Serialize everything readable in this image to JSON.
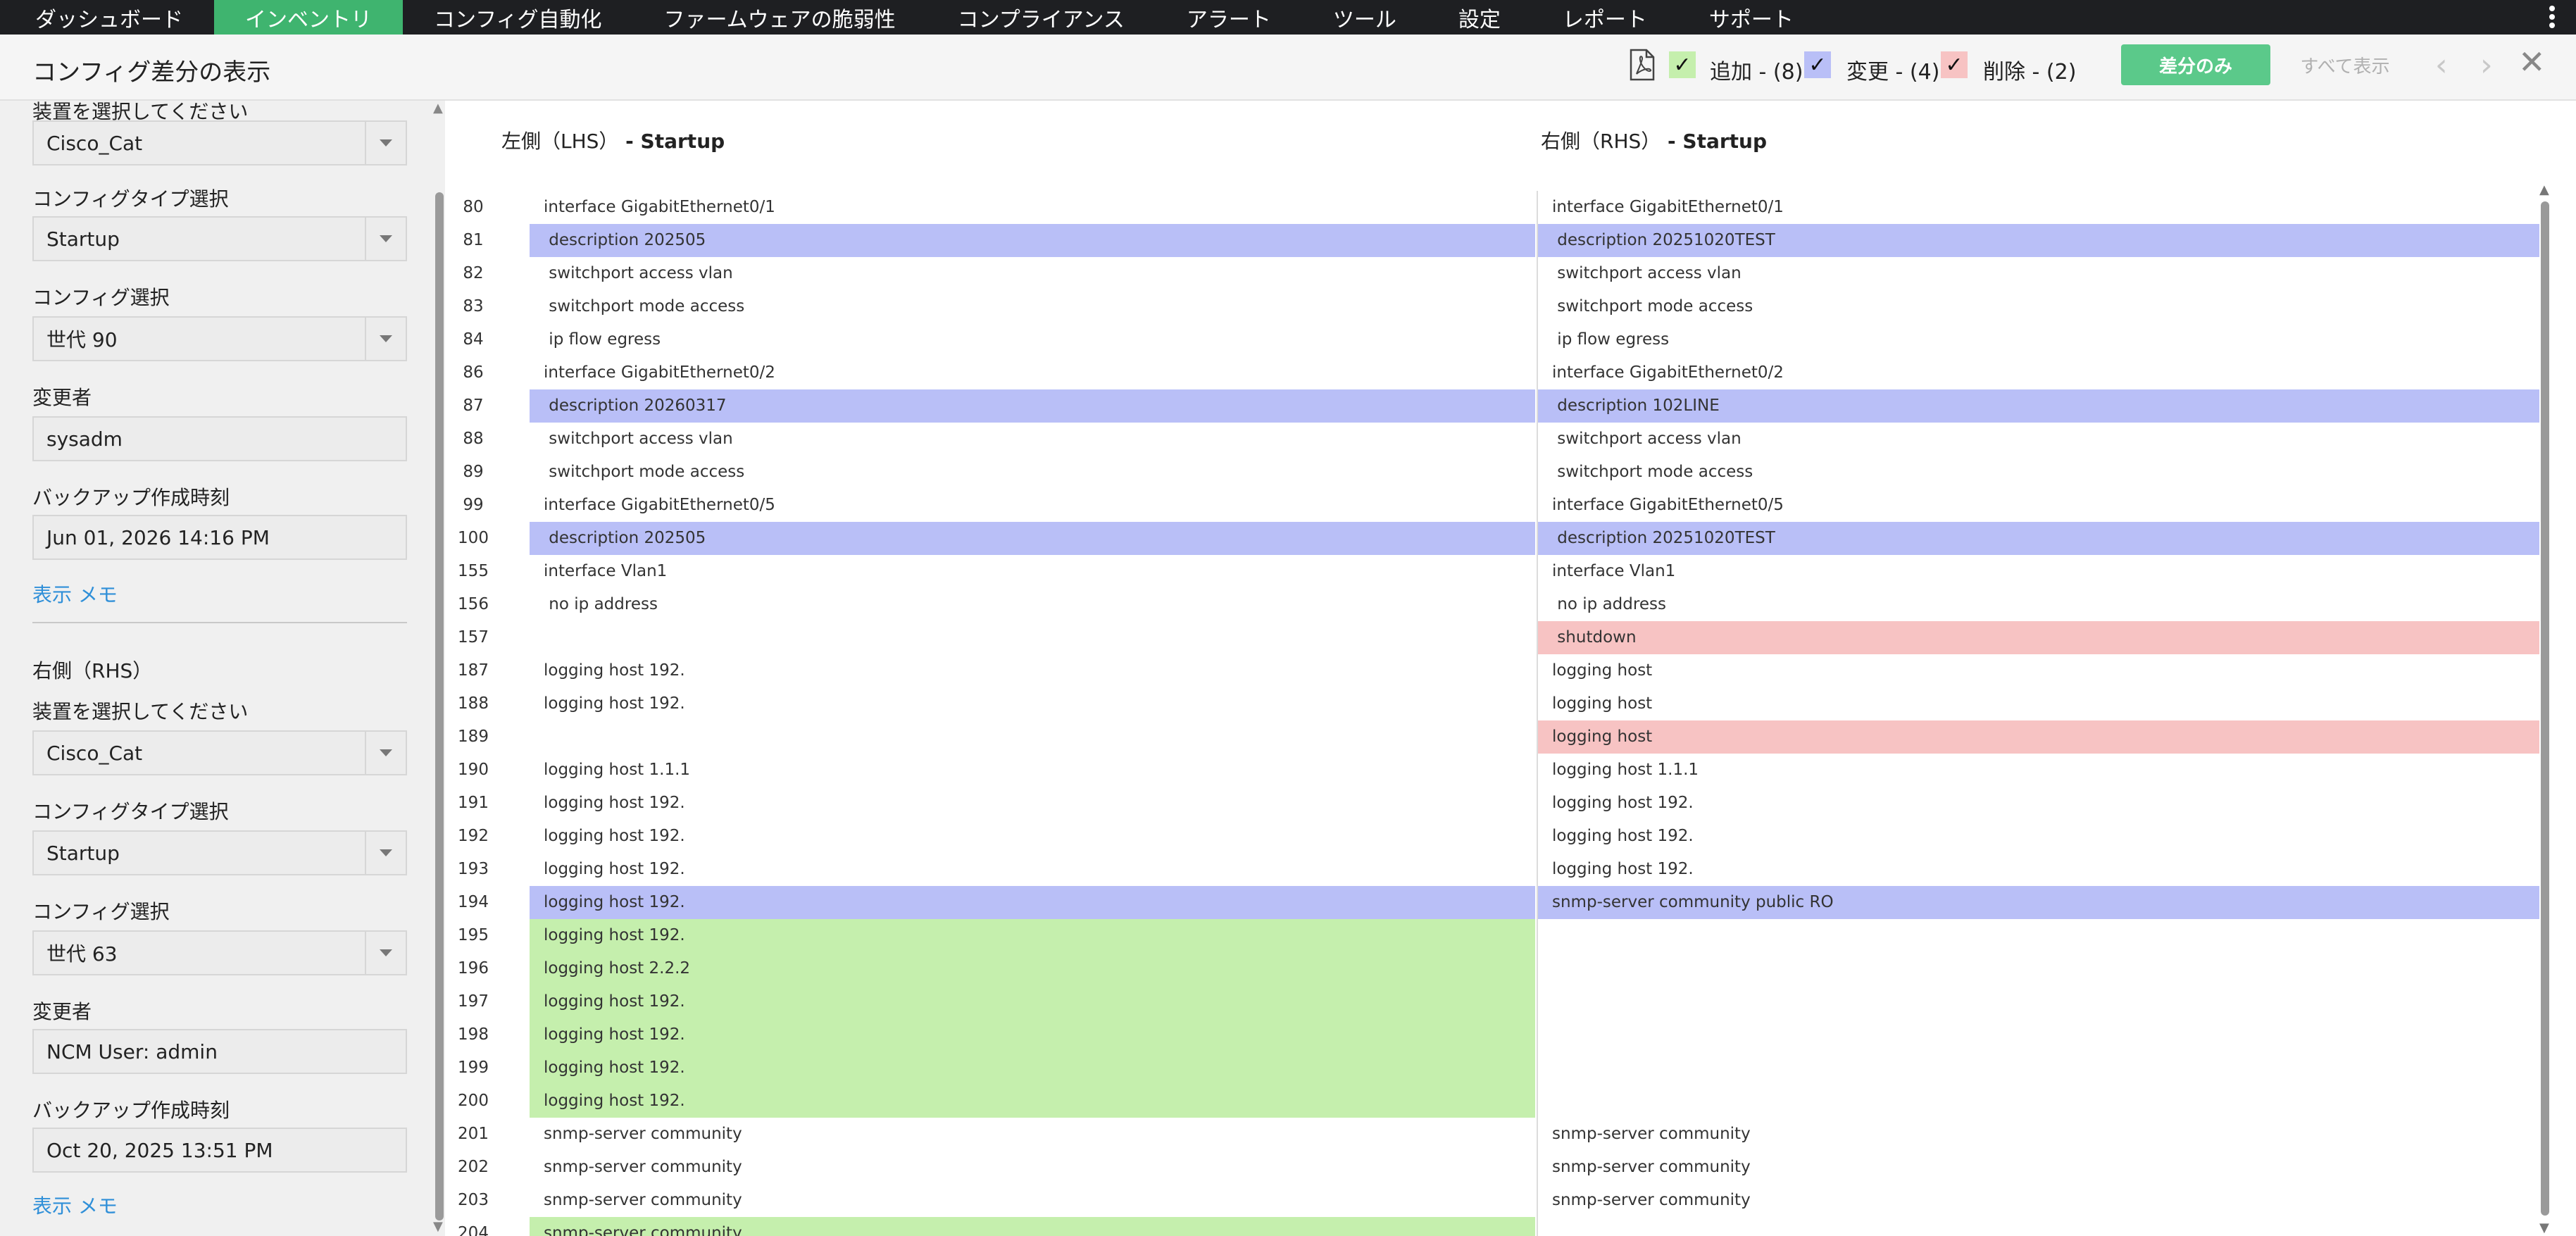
{
  "nav": {
    "items": [
      {
        "label": "ダッシュボード",
        "active": false
      },
      {
        "label": "インベントリ",
        "active": true
      },
      {
        "label": "コンフィグ自動化",
        "active": false
      },
      {
        "label": "ファームウェアの脆弱性",
        "active": false
      },
      {
        "label": "コンプライアンス",
        "active": false
      },
      {
        "label": "アラート",
        "active": false
      },
      {
        "label": "ツール",
        "active": false
      },
      {
        "label": "設定",
        "active": false
      },
      {
        "label": "レポート",
        "active": false
      },
      {
        "label": "サポート",
        "active": false
      }
    ]
  },
  "header": {
    "title": "コンフィグ差分の表示",
    "legend": {
      "added": "追加 - (8)",
      "changed": "変更 - (4)",
      "removed": "削除 - (2)"
    },
    "diff_only_label": "差分のみ",
    "show_all_label": "すべて表示",
    "colors": {
      "added": "#c5efad",
      "changed": "#b9bff7",
      "removed": "#f7c3c3",
      "accent": "#3fb46f"
    }
  },
  "sidebar": {
    "lhs": {
      "device_label": "装置を選択してください",
      "device_value": "Cisco_Cat",
      "config_type_label": "コンフィグタイプ選択",
      "config_type_value": "Startup",
      "config_label": "コンフィグ選択",
      "config_value": "世代 90",
      "changed_by_label": "変更者",
      "changed_by_value": "sysadm",
      "backup_time_label": "バックアップ作成時刻",
      "backup_time_value": "Jun 01, 2026 14:16 PM",
      "memo_link": "表示 メモ"
    },
    "rhs": {
      "section_title": "右側（RHS）",
      "device_label": "装置を選択してください",
      "device_value": "Cisco_Cat",
      "config_type_label": "コンフィグタイプ選択",
      "config_type_value": "Startup",
      "config_label": "コンフィグ選択",
      "config_value": "世代 63",
      "changed_by_label": "変更者",
      "changed_by_value": "NCM User: admin",
      "backup_time_label": "バックアップ作成時刻",
      "backup_time_value": "Oct 20, 2025 13:51 PM",
      "memo_link": "表示 メモ"
    }
  },
  "diff": {
    "lhs_header": {
      "prefix": "左側（LHS）",
      "name": " - Startup"
    },
    "rhs_header": {
      "prefix": "右側（RHS）",
      "name": " - Startup"
    },
    "rows": [
      {
        "num": "80",
        "left": "interface GigabitEthernet0/1",
        "right": "interface GigabitEthernet0/1",
        "status": "same"
      },
      {
        "num": "81",
        "left": " description 202505",
        "right": " description 20251020TEST",
        "status": "changed"
      },
      {
        "num": "82",
        "left": " switchport access vlan",
        "right": " switchport access vlan",
        "status": "same"
      },
      {
        "num": "83",
        "left": " switchport mode access",
        "right": " switchport mode access",
        "status": "same"
      },
      {
        "num": "84",
        "left": " ip flow egress",
        "right": " ip flow egress",
        "status": "same"
      },
      {
        "num": "86",
        "left": "interface GigabitEthernet0/2",
        "right": "interface GigabitEthernet0/2",
        "status": "same"
      },
      {
        "num": "87",
        "left": " description 20260317",
        "right": " description 102LINE",
        "status": "changed"
      },
      {
        "num": "88",
        "left": " switchport access vlan",
        "right": " switchport access vlan",
        "status": "same"
      },
      {
        "num": "89",
        "left": " switchport mode access",
        "right": " switchport mode access",
        "status": "same"
      },
      {
        "num": "99",
        "left": "interface GigabitEthernet0/5",
        "right": "interface GigabitEthernet0/5",
        "status": "same"
      },
      {
        "num": "100",
        "left": " description 202505",
        "right": " description 20251020TEST",
        "status": "changed"
      },
      {
        "num": "155",
        "left": "interface Vlan1",
        "right": "interface Vlan1",
        "status": "same"
      },
      {
        "num": "156",
        "left": " no ip address",
        "right": " no ip address",
        "status": "same"
      },
      {
        "num": "157",
        "left": "",
        "right": " shutdown",
        "status": "removed"
      },
      {
        "num": "187",
        "left": "logging host 192.",
        "right": "logging host",
        "status": "same"
      },
      {
        "num": "188",
        "left": "logging host 192.",
        "right": "logging host",
        "status": "same"
      },
      {
        "num": "189",
        "left": "",
        "right": "logging host",
        "status": "removed"
      },
      {
        "num": "190",
        "left": "logging host 1.1.1",
        "right": "logging host 1.1.1",
        "status": "same"
      },
      {
        "num": "191",
        "left": "logging host 192.",
        "right": "logging host 192.",
        "status": "same"
      },
      {
        "num": "192",
        "left": "logging host 192.",
        "right": "logging host 192.",
        "status": "same"
      },
      {
        "num": "193",
        "left": "logging host 192.",
        "right": "logging host 192.",
        "status": "same"
      },
      {
        "num": "194",
        "left": "logging host 192.",
        "right": "snmp-server community public RO",
        "status": "changed"
      },
      {
        "num": "195",
        "left": "logging host 192.",
        "right": "",
        "status": "added"
      },
      {
        "num": "196",
        "left": "logging host 2.2.2",
        "right": "",
        "status": "added"
      },
      {
        "num": "197",
        "left": "logging host 192.",
        "right": "",
        "status": "added"
      },
      {
        "num": "198",
        "left": "logging host 192.",
        "right": "",
        "status": "added"
      },
      {
        "num": "199",
        "left": "logging host 192.",
        "right": "",
        "status": "added"
      },
      {
        "num": "200",
        "left": "logging host 192.",
        "right": "",
        "status": "added"
      },
      {
        "num": "201",
        "left": "snmp-server community",
        "right": "snmp-server community",
        "status": "same"
      },
      {
        "num": "202",
        "left": "snmp-server community",
        "right": "snmp-server community",
        "status": "same"
      },
      {
        "num": "203",
        "left": "snmp-server community",
        "right": "snmp-server community",
        "status": "same"
      },
      {
        "num": "204",
        "left": "snmp-server community",
        "right": "",
        "status": "added"
      }
    ]
  }
}
